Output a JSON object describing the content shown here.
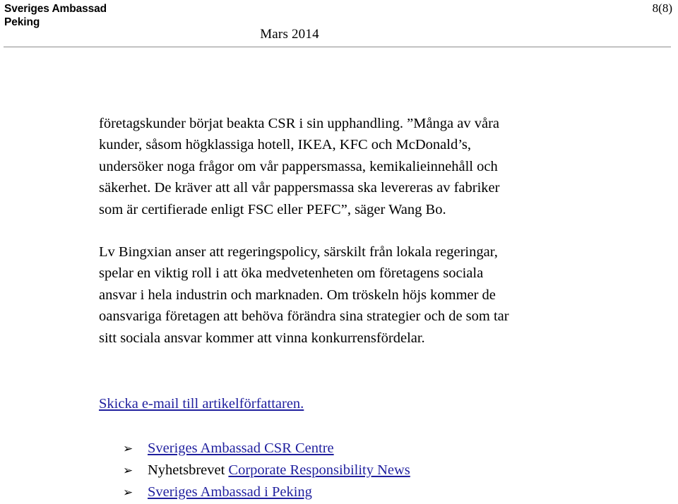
{
  "header": {
    "org_line1": "Sveriges Ambassad",
    "org_line2": "Peking",
    "page_number": "8(8)",
    "date": "Mars 2014"
  },
  "body": {
    "paragraph1_lines": [
      "företagskunder börjat beakta CSR i sin upphandling. ”Många av våra",
      "kunder, såsom högklassiga hotell, IKEA, KFC och McDonald’s,",
      "undersöker noga frågor om vår pappersmassa, kemikalieinnehåll och",
      "säkerhet. De kräver att all vår pappersmassa ska levereras av fabriker",
      "som är certifierade enligt FSC eller PEFC”, säger Wang Bo."
    ],
    "paragraph2_lines": [
      "Lv Bingxian anser att regeringspolicy, särskilt från lokala regeringar,",
      "spelar en viktig roll i att öka medvetenheten om företagens sociala",
      "ansvar i hela industrin och marknaden. Om tröskeln höjs kommer de",
      "oansvariga företagen att behöva förändra sina strategier och de som tar",
      "sitt sociala ansvar kommer att vinna konkurrensfördelar."
    ]
  },
  "links": {
    "email_author": "Skicka e-mail till artikelförfattaren.",
    "bullet_glyph": "➢",
    "list": [
      {
        "prefix": "",
        "link_text": "Sveriges Ambassad CSR Centre"
      },
      {
        "prefix": "Nyhetsbrevet ",
        "link_text": "Corporate Responsibility News"
      },
      {
        "prefix": "",
        "link_text": "Sveriges Ambassad i Peking"
      }
    ]
  },
  "colors": {
    "link": "#1f1f9e",
    "text": "#000000",
    "rule": "#8d8d8d"
  }
}
